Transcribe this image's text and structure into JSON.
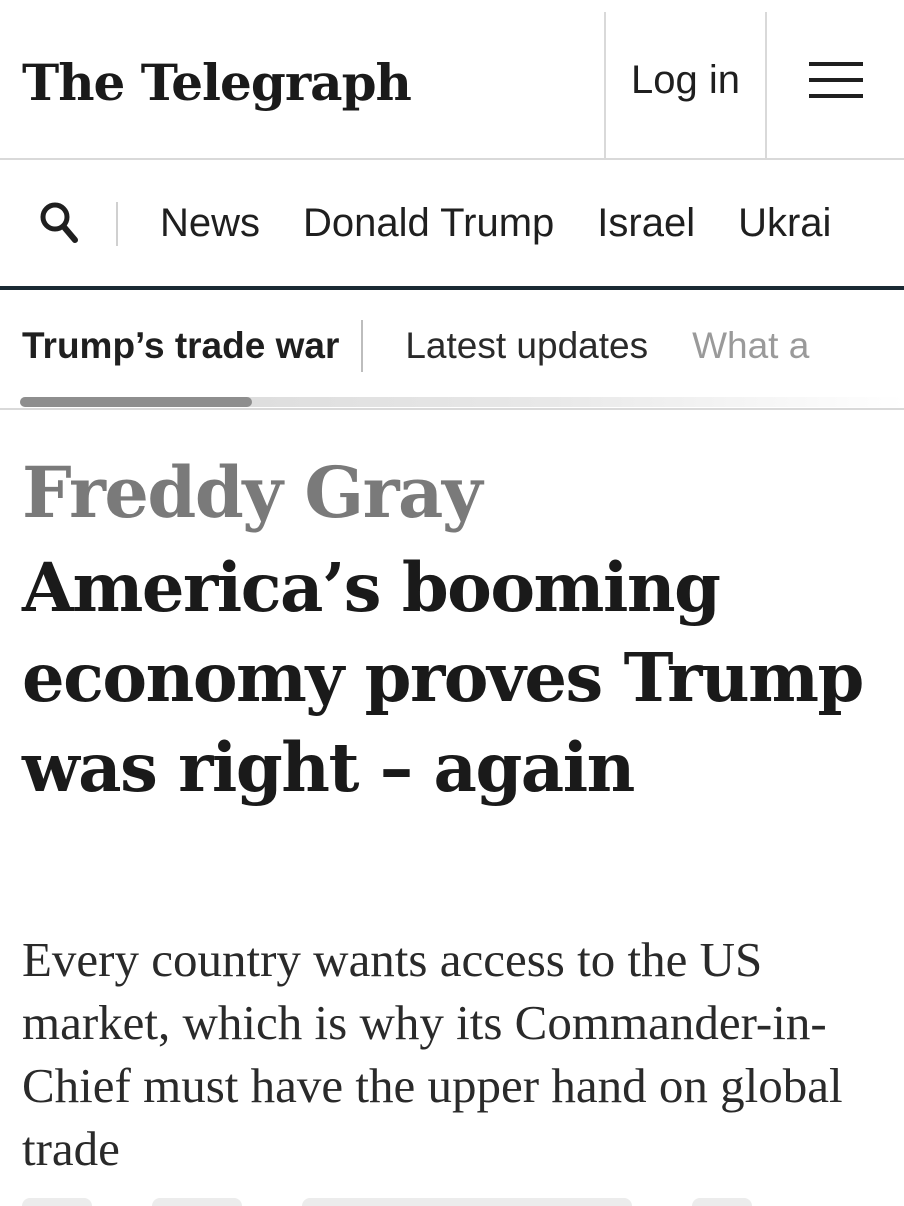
{
  "header": {
    "logo": "The Telegraph",
    "login_label": "Log in",
    "menu_icon": "hamburger-menu-icon"
  },
  "nav": {
    "search_icon": "search-icon",
    "items": [
      {
        "label": "News"
      },
      {
        "label": "Donald Trump"
      },
      {
        "label": "Israel"
      },
      {
        "label": "Ukrai"
      }
    ]
  },
  "subnav": {
    "topic": "Trump’s trade war",
    "items": [
      {
        "label": "Latest updates"
      },
      {
        "label": "What a"
      }
    ]
  },
  "article": {
    "author": "Freddy Gray",
    "headline": "America’s booming economy proves Trump was right – again",
    "standfirst": "Every country wants access to the US market, which is why its Commander-in-Chief must have the upper hand on global trade"
  },
  "colors": {
    "nav_underline": "#1a2a33",
    "author": "#7a7a7a",
    "text": "#1a1a1a"
  }
}
